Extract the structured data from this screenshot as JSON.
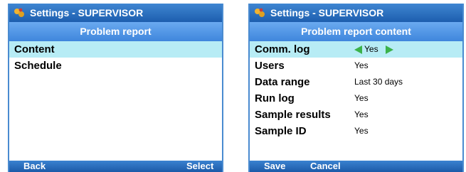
{
  "screens": [
    {
      "title": "Settings - SUPERVISOR",
      "subtitle": "Problem report",
      "items": [
        {
          "label": "Content"
        },
        {
          "label": "Schedule"
        }
      ],
      "softkeys": {
        "left": "Back",
        "right": "Select"
      }
    },
    {
      "title": "Settings - SUPERVISOR",
      "subtitle": "Problem report content",
      "items": [
        {
          "label": "Comm. log",
          "value": "Yes"
        },
        {
          "label": "Users",
          "value": "Yes"
        },
        {
          "label": "Data range",
          "value": "Last 30 days"
        },
        {
          "label": "Run log",
          "value": "Yes"
        },
        {
          "label": "Sample results",
          "value": "Yes"
        },
        {
          "label": "Sample ID",
          "value": "Yes"
        }
      ],
      "softkeys": {
        "left": "Save",
        "right": "Cancel"
      }
    }
  ],
  "icons": {
    "title": "settings-app-icon",
    "selector_left": "arrow-left-icon",
    "selector_right": "arrow-right-icon"
  },
  "colors": {
    "title_bar": "#1d5eae",
    "sub_header": "#4a90e2",
    "selected_row": "#b7ecf5",
    "softkey_bar": "#1b5aa8",
    "selector_arrow": "#3bb24a"
  }
}
